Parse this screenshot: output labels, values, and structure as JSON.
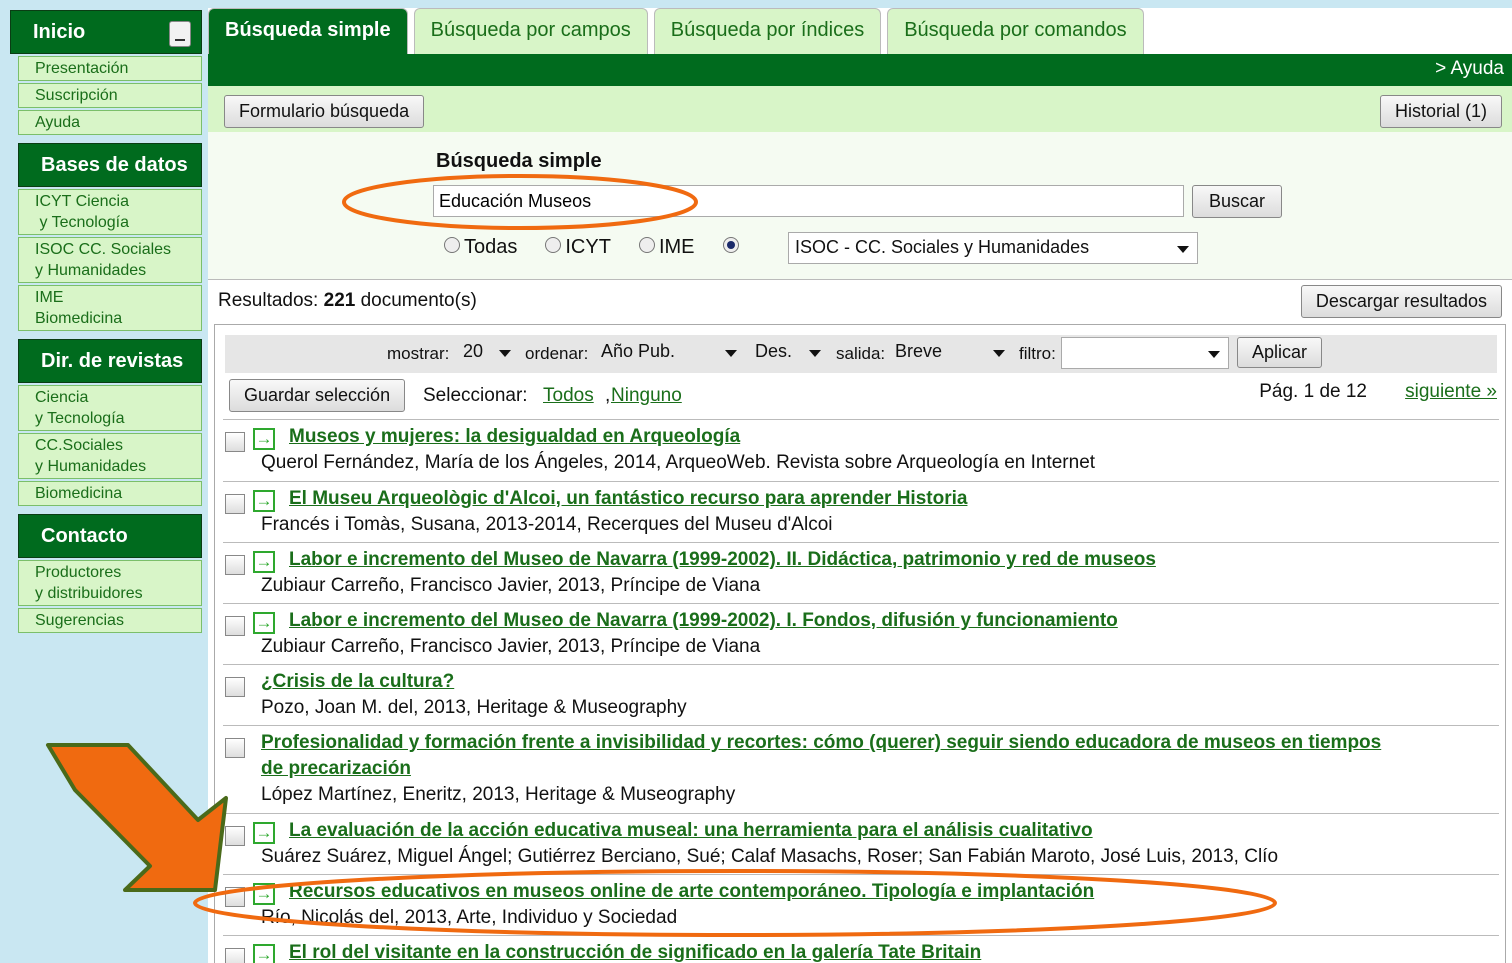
{
  "sidebar": {
    "inicio": "Inicio",
    "inicio_items": [
      "Presentación",
      "Suscripción",
      "Ayuda"
    ],
    "bases": "Bases de datos",
    "bases_items": [
      {
        "line1": "ICYT Ciencia",
        "line2": " y Tecnología"
      },
      {
        "line1": "ISOC CC. Sociales",
        "line2": "y Humanidades"
      },
      {
        "line1": "IME",
        "line2": "Biomedicina"
      }
    ],
    "revistas": "Dir. de revistas",
    "revistas_items": [
      {
        "line1": "Ciencia",
        "line2": "y Tecnología"
      },
      {
        "line1": "CC.Sociales",
        "line2": "y Humanidades"
      },
      {
        "line1": "Biomedicina",
        "line2": ""
      }
    ],
    "contacto": "Contacto",
    "contacto_items": [
      {
        "line1": "Productores",
        "line2": "y distribuidores"
      },
      {
        "line1": "Sugerencias",
        "line2": ""
      }
    ]
  },
  "tabs": [
    "Búsqueda simple",
    "Búsqueda por campos",
    "Búsqueda por índices",
    "Búsqueda por comandos"
  ],
  "help_link": "> Ayuda",
  "toolbar": {
    "form_button": "Formulario búsqueda",
    "history_button": "Historial (1)"
  },
  "search": {
    "title": "Búsqueda simple",
    "query": "Educación Museos",
    "button": "Buscar",
    "radios": [
      "Todas",
      "ICYT",
      "IME"
    ],
    "selected_db": "ISOC - CC. Sociales y Humanidades"
  },
  "results_header": {
    "prefix": "Resultados:",
    "count": "221",
    "suffix": "documento(s)",
    "download": "Descargar resultados"
  },
  "controls": {
    "mostrar_label": "mostrar:",
    "mostrar": "20",
    "ordenar_label": "ordenar:",
    "ordenar": "Año Pub.",
    "order_dir": "Des.",
    "salida_label": "salida:",
    "salida": "Breve",
    "filtro_label": "filtro:",
    "filtro": "",
    "apply": "Aplicar"
  },
  "selection": {
    "save": "Guardar selección",
    "select_label": "Seleccionar:",
    "all": "Todos",
    "comma": ",",
    "none": "Ninguno",
    "page": "Pág. 1 de 12",
    "next": "siguiente »"
  },
  "results": [
    {
      "title": "Museos y mujeres: la desigualdad en Arqueología",
      "title2": "",
      "meta": "Querol Fernández, María de los Ángeles,  2014,  ArqueoWeb. Revista sobre Arqueología en Internet",
      "icon": true
    },
    {
      "title": "El Museu Arqueològic d'Alcoi, un fantástico recurso para aprender Historia",
      "title2": "",
      "meta": "Francés i Tomàs, Susana,  2013-2014,  Recerques del Museu d'Alcoi",
      "icon": true
    },
    {
      "title": "Labor e incremento del Museo de Navarra (1999-2002). II. Didáctica, patrimonio y red de museos",
      "title2": "",
      "meta": "Zubiaur Carreño, Francisco Javier,  2013,  Príncipe de Viana",
      "icon": true
    },
    {
      "title": "Labor e incremento del Museo de Navarra (1999-2002). I. Fondos, difusión y funcionamiento",
      "title2": "",
      "meta": "Zubiaur Carreño, Francisco Javier,  2013,  Príncipe de Viana",
      "icon": true
    },
    {
      "title": "¿Crisis de la cultura?",
      "title2": "",
      "meta": "Pozo, Joan M. del,  2013,  Heritage & Museography",
      "icon": false
    },
    {
      "title": "Profesionalidad y formación frente a invisibilidad y recortes: cómo (querer) seguir siendo educadora de museos en tiempos",
      "title2": "de precarización",
      "meta": "López Martínez, Eneritz,  2013,  Heritage & Museography",
      "icon": false
    },
    {
      "title": "La evaluación de la acción educativa museal: una herramienta para el análisis cualitativo",
      "title2": "",
      "meta": "Suárez Suárez, Miguel Ángel; Gutiérrez Berciano, Sué; Calaf Masachs, Roser; San Fabián Maroto, José Luis,  2013,  Clío",
      "icon": true
    },
    {
      "title": "Recursos educativos en museos online de arte contemporáneo. Tipología e implantación",
      "title2": "",
      "meta": "Río, Nicolás del,  2013,  Arte, Individuo y Sociedad",
      "icon": true
    },
    {
      "title": "El rol del visitante en la construcción de significado en la galería Tate Britain",
      "title2": "",
      "meta": "",
      "icon": true
    }
  ],
  "colors": {
    "green": "#006b1e",
    "light_green": "#d8f5c8",
    "link": "#1a6e1a",
    "annotation": "#f06a10"
  }
}
